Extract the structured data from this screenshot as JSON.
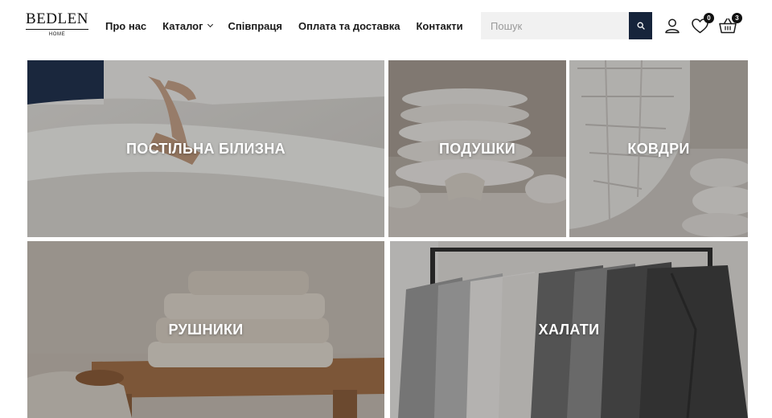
{
  "brand": {
    "name": "BEDLEN",
    "sub": "HOME"
  },
  "nav": {
    "items": [
      {
        "label": "Про нас"
      },
      {
        "label": "Каталог"
      },
      {
        "label": "Співпраця"
      },
      {
        "label": "Оплата та доставка"
      },
      {
        "label": "Контакти"
      }
    ]
  },
  "search": {
    "placeholder": "Пошук"
  },
  "header_icons": {
    "account": "user-icon",
    "wishlist": "heart-icon",
    "wishlist_count": "0",
    "cart": "basket-icon",
    "cart_count": "3"
  },
  "categories": [
    {
      "label": "ПОСТІЛЬНА БІЛИЗНА"
    },
    {
      "label": "ПОДУШКИ"
    },
    {
      "label": "КОВДРИ"
    },
    {
      "label": "РУШНИКИ"
    },
    {
      "label": "ХАЛАТИ"
    }
  ],
  "colors": {
    "search_button": "#16243b",
    "badge": "#111111",
    "label_text": "#ffffff"
  }
}
